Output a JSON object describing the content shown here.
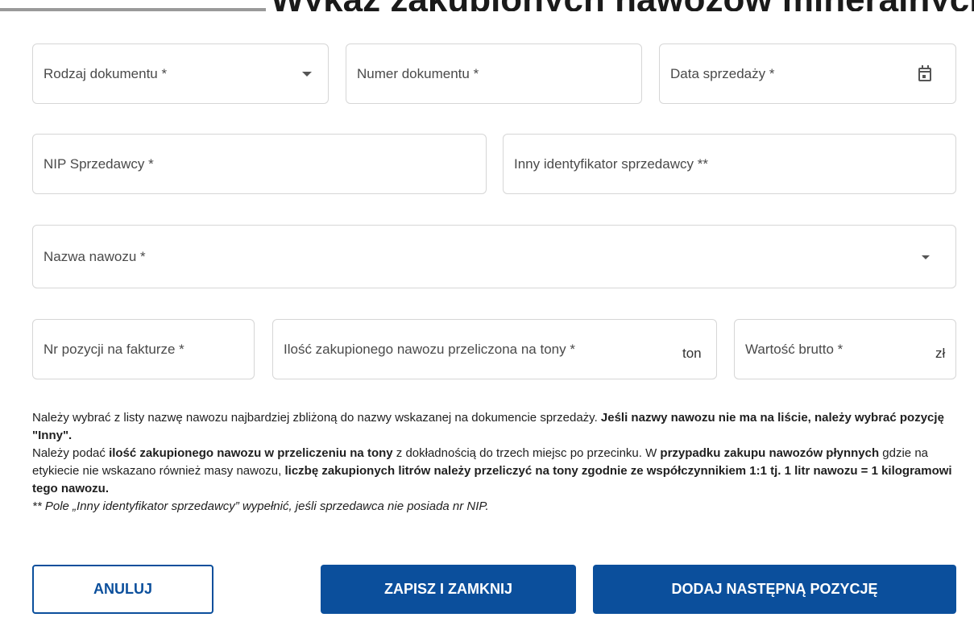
{
  "header": {
    "title": "Wykaz zakupionych nawozów mineralnych"
  },
  "form": {
    "doc_type": {
      "label": "Rodzaj dokumentu *"
    },
    "doc_number": {
      "label": "Numer dokumentu *"
    },
    "sale_date": {
      "label": "Data sprzedaży *"
    },
    "seller_nip": {
      "label": "NIP Sprzedawcy *"
    },
    "seller_other_id": {
      "label": "Inny identyfikator sprzedawcy **"
    },
    "fertilizer_name": {
      "label": "Nazwa nawozu *"
    },
    "invoice_position": {
      "label": "Nr pozycji na fakturze *"
    },
    "quantity": {
      "label": "Ilość zakupionego nawozu przeliczona na tony *",
      "unit": "ton"
    },
    "gross_value": {
      "label": "Wartość brutto *",
      "unit": "zł"
    }
  },
  "help": {
    "p1_a": "Należy wybrać z listy nazwę nawozu najbardziej zbliżoną do nazwy wskazanej na dokumencie sprzedaży. ",
    "p1_b": "Jeśli nazwy nawozu nie ma na liście, należy wybrać pozycję \"Inny\".",
    "p2_a": "Należy podać ",
    "p2_b": "ilość zakupionego nawozu w przeliczeniu na tony",
    "p2_c": " z dokładnością do trzech miejsc po przecinku. W ",
    "p2_d": "przypadku zakupu nawozów płynnych",
    "p2_e": " gdzie na etykiecie nie wskazano również masy nawozu, ",
    "p2_f": "liczbę zakupionych litrów należy przeliczyć na tony zgodnie ze współczynnikiem 1:1 tj. 1 litr nawozu = 1 kilogramowi tego nawozu.",
    "p3": "** Pole „Inny identyfikator sprzedawcy” wypełnić, jeśli sprzedawca nie posiada nr NIP."
  },
  "buttons": {
    "cancel": "ANULUJ",
    "save_close": "ZAPISZ I ZAMKNIJ",
    "add_next": "DODAJ NASTĘPNĄ POZYCJĘ"
  }
}
